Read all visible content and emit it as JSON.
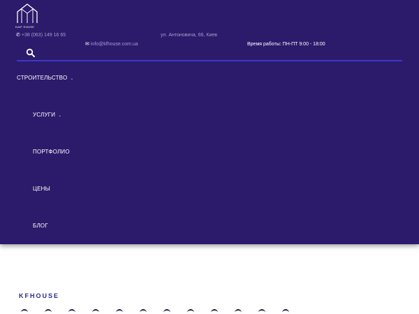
{
  "header": {
    "logo": {
      "text": "KAIF HOUSE",
      "icon": "house-logo-icon"
    },
    "phone": {
      "icon": "phone-icon",
      "text": "+38 (063) 149 16 65"
    },
    "email": {
      "icon": "envelope-icon",
      "text": "info@kfhouse.com.ua"
    },
    "address": "ул. Антоновича, 66, Киев",
    "hours": "Время работы: ПН-ПТ 9:00 - 18:00",
    "search_icon": "search-icon"
  },
  "menu": {
    "items": [
      {
        "label": "СТРОИТЕЛЬСТВО",
        "has_submenu": true
      },
      {
        "label": "УСЛУГИ",
        "has_submenu": true
      },
      {
        "label": "ПОРТФОЛИО",
        "has_submenu": false
      },
      {
        "label": "ЦЕНЫ",
        "has_submenu": false
      },
      {
        "label": "БЛОГ",
        "has_submenu": false
      }
    ]
  },
  "section": {
    "brand": "KFHOUSE"
  },
  "colors": {
    "header_bg": "#2c1a6b",
    "accent_line": "#3b39c8",
    "brand_text": "#2c2a8a"
  }
}
